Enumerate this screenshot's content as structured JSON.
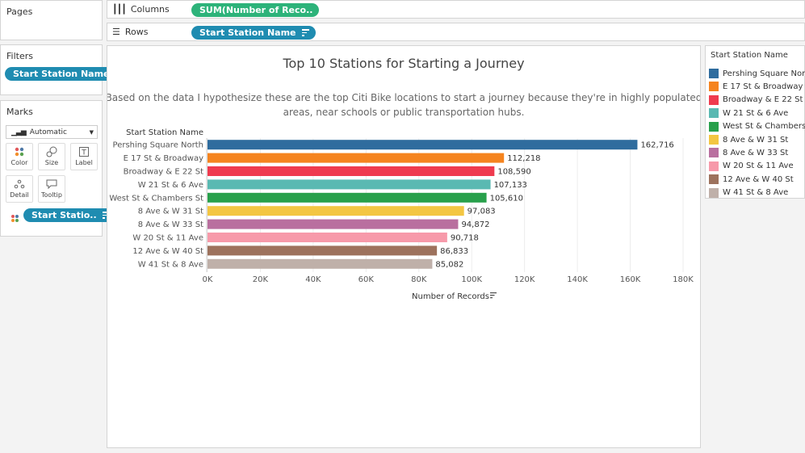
{
  "pages": {
    "title": "Pages"
  },
  "columns_shelf": {
    "label": "Columns",
    "pill": "SUM(Number of Reco.."
  },
  "rows_shelf": {
    "label": "Rows",
    "pill": "Start Station Name"
  },
  "filters": {
    "title": "Filters",
    "pill": "Start Station Name"
  },
  "marks": {
    "title": "Marks",
    "type": "Automatic",
    "buttons": {
      "color": "Color",
      "size": "Size",
      "label": "Label",
      "detail": "Detail",
      "tooltip": "Tooltip"
    },
    "color_pill": "Start Statio.."
  },
  "legend": {
    "title": "Start Station Name",
    "items": [
      {
        "label": "Pershing Square Nor..",
        "color": "#2f6c9e"
      },
      {
        "label": "E 17 St & Broadway",
        "color": "#f5841f"
      },
      {
        "label": "Broadway & E 22 St",
        "color": "#ef3b4f"
      },
      {
        "label": "W 21 St & 6 Ave",
        "color": "#5ab9b2"
      },
      {
        "label": "West St & Chambers ..",
        "color": "#28a04b"
      },
      {
        "label": "8 Ave & W 31 St",
        "color": "#f3c642"
      },
      {
        "label": "8 Ave & W 33 St",
        "color": "#b96f9f"
      },
      {
        "label": "W 20 St & 11 Ave",
        "color": "#f79aaa"
      },
      {
        "label": "12 Ave & W 40 St",
        "color": "#9d725d"
      },
      {
        "label": "W 41 St & 8 Ave",
        "color": "#bfb0a9"
      }
    ]
  },
  "chart_data": {
    "type": "bar",
    "orientation": "horizontal",
    "title": "Top 10 Stations for Starting a Journey",
    "subtitle_line1": "Based on the data I hypothesize these are the top Citi Bike locations to start a journey because they're in highly populated",
    "subtitle_line2": "areas, near schools or public transportation hubs.",
    "row_header": "Start Station Name",
    "xlabel": "Number of Records",
    "xlim": [
      0,
      180000
    ],
    "xticks": [
      0,
      20000,
      40000,
      60000,
      80000,
      100000,
      120000,
      140000,
      160000,
      180000
    ],
    "xtick_labels": [
      "0K",
      "20K",
      "40K",
      "60K",
      "80K",
      "100K",
      "120K",
      "140K",
      "160K",
      "180K"
    ],
    "categories": [
      "Pershing Square North",
      "E 17 St & Broadway",
      "Broadway & E 22 St",
      "W 21 St & 6 Ave",
      "West St & Chambers St",
      "8 Ave & W 31 St",
      "8 Ave & W 33 St",
      "W 20 St & 11 Ave",
      "12 Ave & W 40 St",
      "W 41 St & 8 Ave"
    ],
    "values": [
      162716,
      112218,
      108590,
      107133,
      105610,
      97083,
      94872,
      90718,
      86833,
      85082
    ],
    "value_labels": [
      "162,716",
      "112,218",
      "108,590",
      "107,133",
      "105,610",
      "97,083",
      "94,872",
      "90,718",
      "86,833",
      "85,082"
    ],
    "colors": [
      "#2f6c9e",
      "#f5841f",
      "#ef3b4f",
      "#5ab9b2",
      "#28a04b",
      "#f3c642",
      "#b96f9f",
      "#f79aaa",
      "#9d725d",
      "#bfb0a9"
    ],
    "grid": "vertical"
  }
}
